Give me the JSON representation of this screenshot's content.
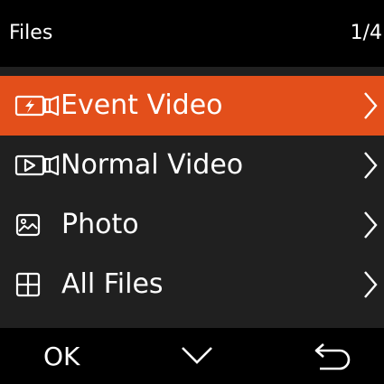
{
  "header": {
    "title": "Files",
    "page_indicator": "1/4"
  },
  "menu": {
    "items": [
      {
        "label": "Event Video",
        "icon": "event-video-icon",
        "selected": true
      },
      {
        "label": "Normal Video",
        "icon": "normal-video-icon",
        "selected": false
      },
      {
        "label": "Photo",
        "icon": "photo-icon",
        "selected": false
      },
      {
        "label": "All Files",
        "icon": "grid-icon",
        "selected": false
      }
    ]
  },
  "bottom_bar": {
    "ok_label": "OK",
    "down_icon": "chevron-down-icon",
    "back_icon": "back-arrow-icon"
  },
  "colors": {
    "accent": "#e34f1b",
    "background": "#202020",
    "bar": "#000000",
    "text": "#ffffff"
  }
}
